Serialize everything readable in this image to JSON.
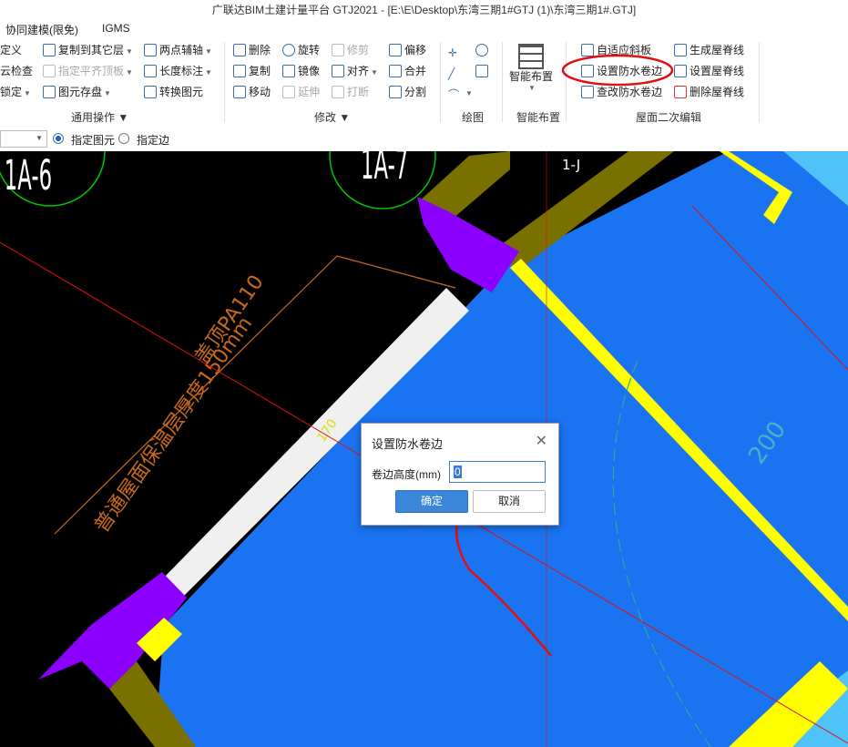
{
  "window": {
    "title": "广联达BIM土建计量平台 GTJ2021 - [E:\\E\\Desktop\\东湾三期1#GTJ (1)\\东湾三期1#.GTJ]"
  },
  "menubar": {
    "items": [
      "协同建模(限免)",
      "IGMS"
    ]
  },
  "ribbon": {
    "general": {
      "items": [
        "定义",
        "云检查",
        "锁定",
        "复制到其它层",
        "指定平齐顶板",
        "图元存盘",
        "两点辅轴",
        "长度标注",
        "转换图元"
      ],
      "label": "通用操作"
    },
    "modify": {
      "items": [
        "删除",
        "旋转",
        "修剪",
        "偏移",
        "复制",
        "镜像",
        "对齐",
        "合并",
        "移动",
        "延伸",
        "打断",
        "分割"
      ],
      "label": "修改"
    },
    "draw": {
      "label": "绘图"
    },
    "smart": {
      "button": "智能布置",
      "label": "智能布置"
    },
    "roof": {
      "items": [
        "自适应斜板",
        "生成屋脊线",
        "设置防水卷边",
        "设置屋脊线",
        "查改防水卷边",
        "删除屋脊线"
      ],
      "label": "屋面二次编辑"
    }
  },
  "options": {
    "radio1": "指定图元",
    "radio2": "指定边"
  },
  "canvas": {
    "labels": [
      "1A-6",
      "1A-7",
      "1-J",
      "盖顶PA110",
      "普通屋面保温层厚度150mm",
      "200",
      "170"
    ]
  },
  "dialog": {
    "title": "设置防水卷边",
    "field_label": "卷边高度(mm)",
    "field_value": "0",
    "ok": "确定",
    "cancel": "取消"
  },
  "colors": {
    "canvas_bg": "#000000",
    "slab_blue": "#1a73f0",
    "light_blue": "#4fc3f7",
    "wall_yellow": "#ffff00",
    "beam_olive": "#7a7000",
    "column_purple": "#8b00ff",
    "annotation_red": "#e01010"
  },
  "icons": [
    "dropdown-arrow-icon",
    "radio-selected-icon",
    "radio-empty-icon",
    "close-icon"
  ]
}
